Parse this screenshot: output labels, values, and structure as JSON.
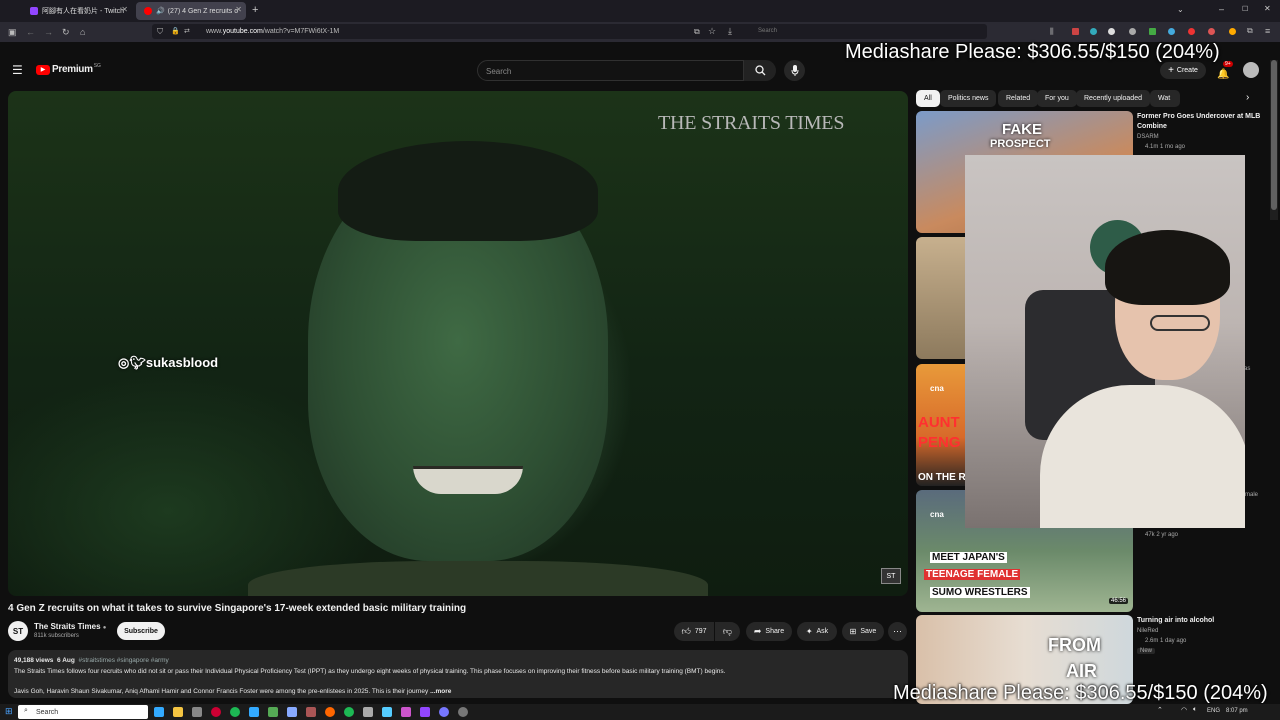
{
  "browser": {
    "tabs": [
      {
        "title": "阿腳有人在看奶片 - Twitch"
      },
      {
        "title": "(27) 4 Gen Z recruits on wh"
      }
    ],
    "url_prefix": "www.",
    "url_host": "youtube.com",
    "url_path": "/watch?v=M7FWi6tX-1M",
    "search_placeholder": "Search"
  },
  "youtube": {
    "logo": "Premium",
    "logo_badge": "SG",
    "search_placeholder": "Search",
    "create_label": "Create",
    "notif_count": "9+"
  },
  "video": {
    "watermark": "THE STRAITS TIMES",
    "corner_logo": "ST",
    "title": "4 Gen Z recruits on what it takes to survive Singapore's 17-week extended basic military training",
    "channel": "The Straits Times",
    "channel_avatar": "ST",
    "subscribers": "811k subscribers",
    "subscribe_label": "Subscribe",
    "likes": "797",
    "share_label": "Share",
    "ask_label": "Ask",
    "save_label": "Save",
    "views": "49,188 views",
    "date": "6 Aug",
    "hashtags": "#straitstimes #singapore #army",
    "desc_line1": "The Straits Times follows four recruits who did not sit or pass their Individual Physical Proficiency Test (IPPT) as they undergo eight weeks of physical training. This phase focuses on improving their fitness before basic military training (BMT) begins.",
    "desc_line2": "Javis Goh, Haravin Shaun Sivakumar, Aniq Afhami Hamir and Connor Francis Foster were among the pre-enlistees in 2025. This is their journey",
    "more_label": "...more"
  },
  "sidebar": {
    "chips": [
      "All",
      "Politics news",
      "Related",
      "For you",
      "Recently uploaded",
      "Wat"
    ],
    "items": [
      {
        "thumb_text1": "FAKE",
        "thumb_text2": "PROSPECT",
        "title_l1": "Former Pro Goes Undercover at MLB",
        "title_l2": "Combine",
        "channel": "DSARM",
        "meta": "4.1m  1 mo ago"
      },
      {
        "thumb_text1": "",
        "thumb_text2": "",
        "title_l1": "",
        "title_l2": "",
        "channel": "",
        "meta": ""
      },
      {
        "thumb_text1": "AUNT",
        "thumb_text2": "PENG",
        "thumb_text3": "ON THE RED",
        "thumb_brand": "cna",
        "title_l1": "",
        "title_l2": "",
        "channel": "",
        "meta": ""
      },
      {
        "thumb_text1": "MEET JAPAN'S",
        "thumb_text2": "TEENAGE FEMALE",
        "thumb_text3": "SUMO WRESTLERS",
        "thumb_brand": "cna",
        "duration": "46:56",
        "title_l1": "",
        "title_l2": "",
        "channel": "",
        "meta": "47k  2 yr ago"
      },
      {
        "thumb_text1": "FROM",
        "thumb_text2": "AIR",
        "title_l1": "Turning air into alcohol",
        "title_l2": "",
        "channel": "NileRed",
        "meta": "2.6m  1 day ago",
        "badge": "New"
      }
    ],
    "partial_fragments": [
      "as",
      "male"
    ]
  },
  "overlays": {
    "mediashare_top": "Mediashare Please: $306.55/$150 (204%)",
    "mediashare_bottom": "Mediashare Please: $306.55/$150 (204%)",
    "cam_handle": "sukasblood"
  },
  "taskbar": {
    "search_placeholder": "Search",
    "lang": "ENG",
    "time": "8:07 pm"
  },
  "colors": {
    "youtube_red": "#ff0000",
    "accent_blue": "#3ea6ff",
    "browser_tab_active": "#42414d",
    "twitch_purple": "#9146ff"
  }
}
